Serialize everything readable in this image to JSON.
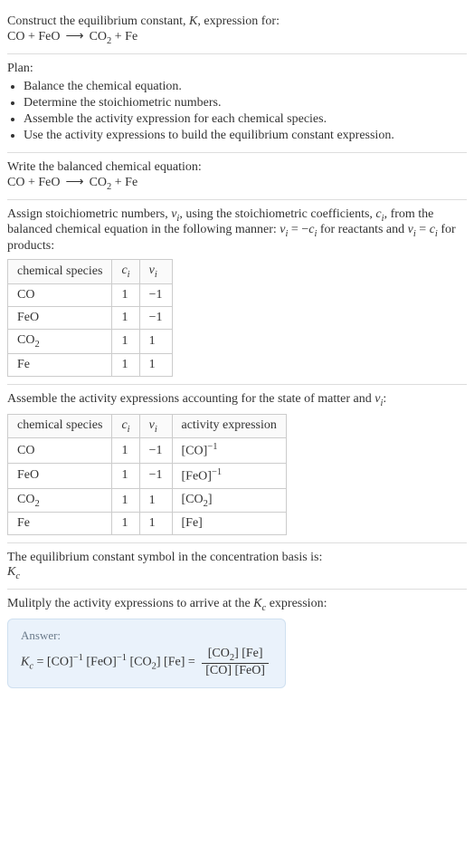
{
  "intro": {
    "line1": "Construct the equilibrium constant, ",
    "K": "K",
    "line1b": ", expression for:",
    "eq_lhs1": "CO",
    "plus": " + ",
    "eq_lhs2": "FeO",
    "arrow": "⟶",
    "eq_rhs1": "CO",
    "eq_rhs1_sub": "2",
    "eq_rhs2": "Fe"
  },
  "plan": {
    "heading": "Plan:",
    "items": [
      "Balance the chemical equation.",
      "Determine the stoichiometric numbers.",
      "Assemble the activity expression for each chemical species.",
      "Use the activity expressions to build the equilibrium constant expression."
    ]
  },
  "balanced": {
    "heading": "Write the balanced chemical equation:"
  },
  "assign": {
    "text1": "Assign stoichiometric numbers, ",
    "nu": "ν",
    "i": "i",
    "text2": ", using the stoichiometric coefficients, ",
    "c": "c",
    "text3": ", from the balanced chemical equation in the following manner: ",
    "eq_reactants": " = −",
    "text4": " for reactants and ",
    "eq_products": " = ",
    "text5": " for products:"
  },
  "table1": {
    "headers": {
      "species": "chemical species",
      "ci": "c",
      "ci_sub": "i",
      "nui": "ν",
      "nui_sub": "i"
    },
    "rows": [
      {
        "species": "CO",
        "ci": "1",
        "nui": "−1"
      },
      {
        "species": "FeO",
        "ci": "1",
        "nui": "−1"
      },
      {
        "species_a": "CO",
        "species_sub": "2",
        "ci": "1",
        "nui": "1"
      },
      {
        "species": "Fe",
        "ci": "1",
        "nui": "1"
      }
    ]
  },
  "assemble": {
    "text1": "Assemble the activity expressions accounting for the state of matter and ",
    "colon": ":"
  },
  "table2": {
    "headers": {
      "species": "chemical species",
      "ci": "c",
      "ci_sub": "i",
      "nui": "ν",
      "nui_sub": "i",
      "activity": "activity expression"
    },
    "rows": [
      {
        "species": "CO",
        "ci": "1",
        "nui": "−1",
        "act_base": "[CO]",
        "act_exp": "−1"
      },
      {
        "species": "FeO",
        "ci": "1",
        "nui": "−1",
        "act_base": "[FeO]",
        "act_exp": "−1"
      },
      {
        "species_a": "CO",
        "species_sub": "2",
        "ci": "1",
        "nui": "1",
        "act_base_a": "[CO",
        "act_base_sub": "2",
        "act_base_b": "]"
      },
      {
        "species": "Fe",
        "ci": "1",
        "nui": "1",
        "act_base": "[Fe]"
      }
    ]
  },
  "symbol": {
    "text": "The equilibrium constant symbol in the concentration basis is:",
    "Kc_K": "K",
    "Kc_c": "c"
  },
  "multiply": {
    "text1": "Mulitply the activity expressions to arrive at the ",
    "text2": " expression:"
  },
  "answer": {
    "label": "Answer:",
    "Kc_K": "K",
    "Kc_c": "c",
    "eq": " = ",
    "t1": "[CO]",
    "t1_exp": "−1",
    "sp": " ",
    "t2": "[FeO]",
    "t2_exp": "−1",
    "t3a": "[CO",
    "t3_sub": "2",
    "t3b": "]",
    "t4": "[Fe]",
    "frac_num_a": "[CO",
    "frac_num_sub": "2",
    "frac_num_b": "] [Fe]",
    "frac_den": "[CO] [FeO]"
  },
  "chart_data": {
    "type": "table",
    "tables": [
      {
        "title": "Stoichiometric numbers",
        "columns": [
          "chemical species",
          "c_i",
          "ν_i"
        ],
        "rows": [
          [
            "CO",
            1,
            -1
          ],
          [
            "FeO",
            1,
            -1
          ],
          [
            "CO2",
            1,
            1
          ],
          [
            "Fe",
            1,
            1
          ]
        ]
      },
      {
        "title": "Activity expressions",
        "columns": [
          "chemical species",
          "c_i",
          "ν_i",
          "activity expression"
        ],
        "rows": [
          [
            "CO",
            1,
            -1,
            "[CO]^-1"
          ],
          [
            "FeO",
            1,
            -1,
            "[FeO]^-1"
          ],
          [
            "CO2",
            1,
            1,
            "[CO2]"
          ],
          [
            "Fe",
            1,
            1,
            "[Fe]"
          ]
        ]
      }
    ]
  }
}
